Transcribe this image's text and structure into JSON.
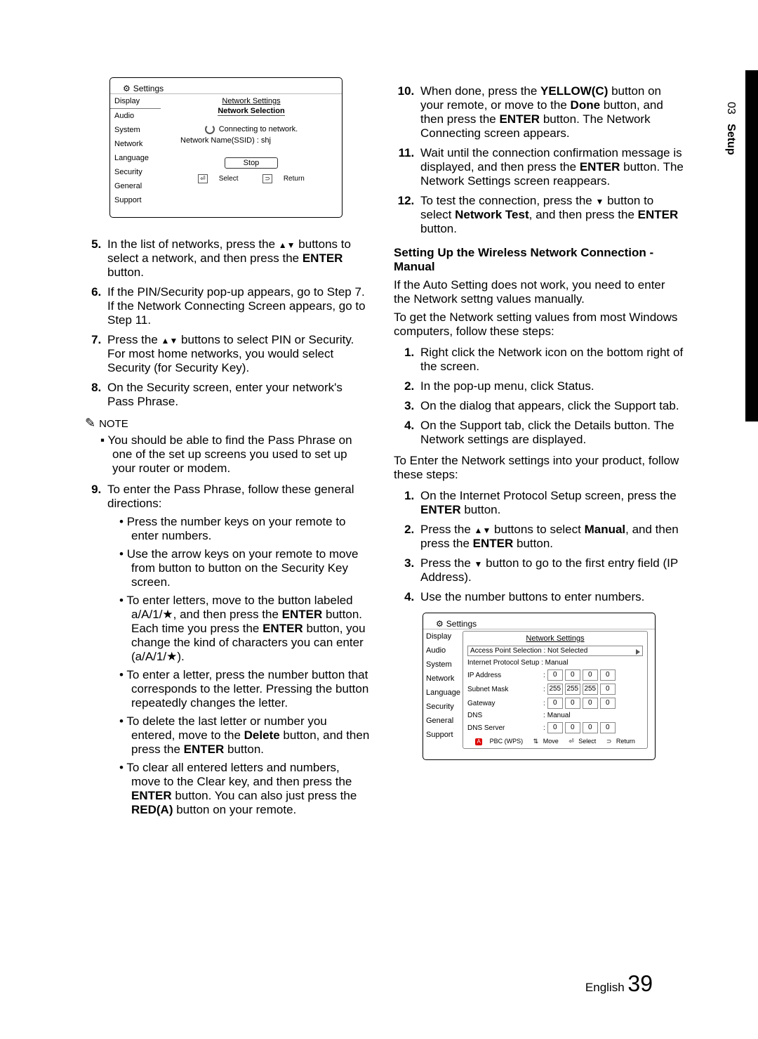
{
  "side": {
    "chapter": "03",
    "section": "Setup"
  },
  "footer": {
    "lang": "English",
    "page": "39"
  },
  "tv1": {
    "settings_label": "Settings",
    "menu": [
      "Display",
      "Audio",
      "System",
      "Network",
      "Language",
      "Security",
      "General",
      "Support"
    ],
    "panel_title": "Network Settings",
    "panel_sub": "Network Selection",
    "connecting": "Connecting to network.",
    "ssid_line": "Network Name(SSID) : shj",
    "stop": "Stop",
    "foot_select": "Select",
    "foot_return": "Return"
  },
  "tv2": {
    "settings_label": "Settings",
    "menu": [
      "Display",
      "Audio",
      "System",
      "Network",
      "Language",
      "Security",
      "General",
      "Support"
    ],
    "panel_title": "Network Settings",
    "aps_label": "Access Point Selection  : Not Selected",
    "ips_label": "Internet Protocol Setup  : Manual",
    "ip_label": "IP Address",
    "ip": [
      "0",
      "0",
      "0",
      "0"
    ],
    "sm_label": "Subnet Mask",
    "sm": [
      "255",
      "255",
      "255",
      "0"
    ],
    "gw_label": "Gateway",
    "gw": [
      "0",
      "0",
      "0",
      "0"
    ],
    "dns_label": "DNS",
    "dns_mode": "Manual",
    "dnssrv_label": "DNS Server",
    "dnssrv": [
      "0",
      "0",
      "0",
      "0"
    ],
    "foot_pbc": "PBC (WPS)",
    "foot_move": "Move",
    "foot_select": "Select",
    "foot_return": "Return"
  },
  "left": {
    "s5a": "In the list of networks, press the ",
    "s5b": " buttons to select a network, and then press the ",
    "s5c": "ENTER",
    "s5d": " button.",
    "s6": "If the PIN/Security pop-up appears, go to Step 7. If the Network Connecting Screen appears, go to Step 11.",
    "s7a": "Press the ",
    "s7b": " buttons to select PIN or Security.",
    "s7c": "For most home networks, you would select Security (for Security Key).",
    "s8": "On the Security screen, enter your network's Pass Phrase.",
    "note_hdr": "NOTE",
    "note_body": "You should be able to find the Pass Phrase on one of the set up screens you used to set up your router or modem.",
    "s9": "To enter the Pass Phrase, follow these general directions:",
    "b1": "Press the number keys on your remote to enter numbers.",
    "b2": "Use the arrow keys on your remote to move from button to button on the Security Key screen.",
    "b3a": "To enter letters, move to the button labeled a/A/1/★, and then press the ",
    "b3b": "ENTER",
    "b3c": " button. Each time you press the ",
    "b3d": "ENTER",
    "b3e": " button, you change the kind of characters you can enter (a/A/1/★).",
    "b4": "To enter a letter, press the number button that corresponds to the letter. Pressing the button repeatedly changes the letter.",
    "b5a": "To delete the last letter or number you entered, move to the ",
    "b5b": "Delete",
    "b5c": " button, and then press the ",
    "b5d": "ENTER",
    "b5e": " button.",
    "b6a": "To clear all entered letters and numbers, move to the Clear key, and then press the ",
    "b6b": "ENTER",
    "b6c": " button. You can also just press the ",
    "b6d": "RED(A)",
    "b6e": " button on your remote."
  },
  "right": {
    "s10a": "When done, press the ",
    "s10b": "YELLOW(C)",
    "s10c": " button on your remote, or move to the ",
    "s10d": "Done",
    "s10e": " button, and then press the ",
    "s10f": "ENTER",
    "s10g": " button. The Network Connecting screen appears.",
    "s11a": "Wait until the connection confirmation message is displayed, and then press the ",
    "s11b": "ENTER",
    "s11c": " button. The Network Settings screen reappears.",
    "s12a": "To test the connection, press the ",
    "s12b": " button to select ",
    "s12c": "Network Test",
    "s12d": ", and then press the ",
    "s12e": "ENTER",
    "s12f": " button.",
    "heading": "Setting Up the Wireless Network Connection - Manual",
    "p1": "If the Auto Setting does not work, you need to enter the Network settng values manually.",
    "p2": "To get the Network setting values from most Windows computers, follow these steps:",
    "m1": "Right click the Network icon on the bottom right of the screen.",
    "m2": "In the pop-up menu, click Status.",
    "m3": "On the dialog that appears, click the Support tab.",
    "m4": "On the Support tab, click the Details button. The Network settings are displayed.",
    "p3": "To Enter the Network settings into your product, follow these steps:",
    "e1a": "On the Internet Protocol Setup screen, press the ",
    "e1b": "ENTER",
    "e1c": " button.",
    "e2a": "Press the ",
    "e2b": " buttons to select ",
    "e2c": "Manual",
    "e2d": ", and then press the ",
    "e2e": "ENTER",
    "e2f": " button.",
    "e3a": "Press the ",
    "e3b": " button to go to the first entry field (IP Address).",
    "e4": "Use the number buttons to enter numbers."
  }
}
